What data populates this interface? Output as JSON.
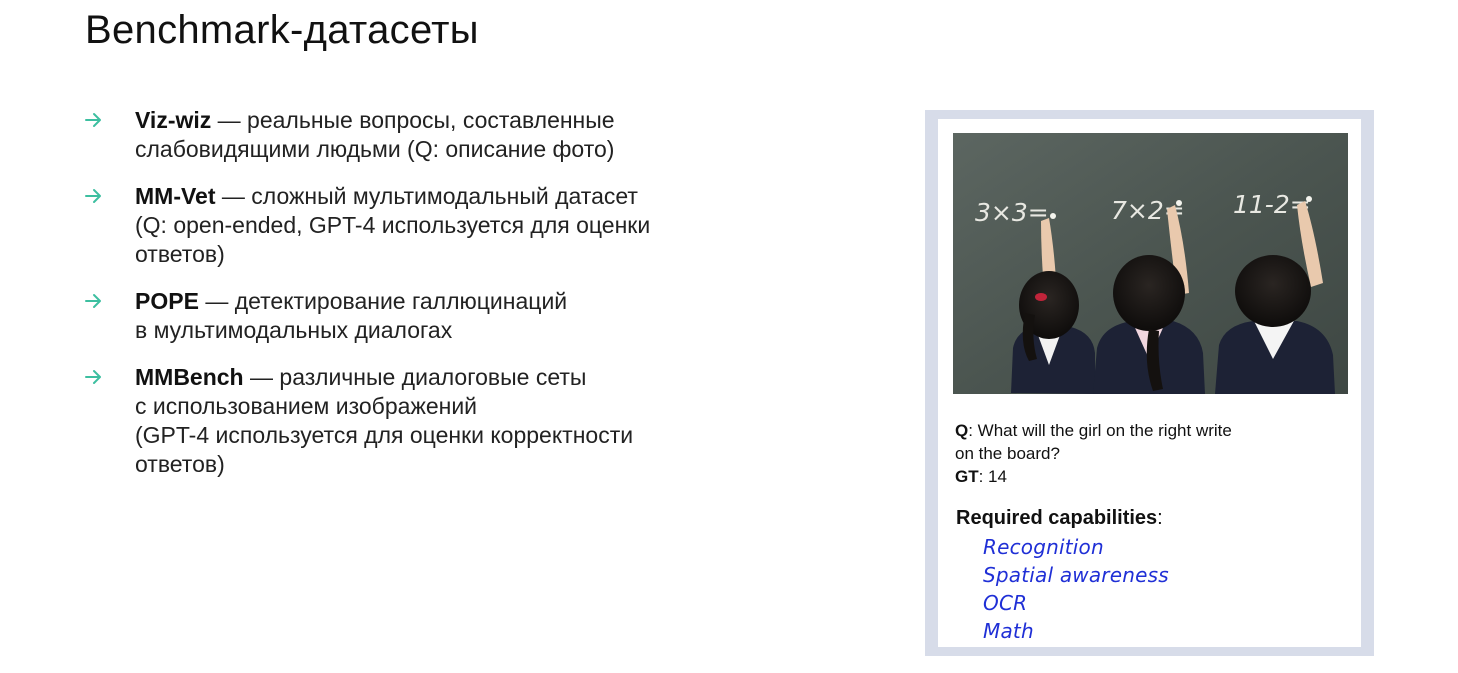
{
  "title": "Benchmark-датасеты",
  "accent_color": "#3dbfa0",
  "bullets": [
    {
      "name": "Viz-wiz",
      "lines": [
        "— реальные вопросы, составленные",
        "слабовидящими людьми (Q: описание фото)"
      ]
    },
    {
      "name": "MM-Vet",
      "lines": [
        "— сложный мультимодальный датасет",
        "(Q: open-ended, GPT-4 используется для оценки",
        "ответов)"
      ]
    },
    {
      "name": "POPE",
      "lines": [
        "— детектирование галлюцинаций",
        "в мультимодальных диалогах"
      ]
    },
    {
      "name": "MMBench",
      "lines": [
        "— различные диалоговые сеты",
        "с использованием изображений",
        "(GPT-4 используется для оценки корректности",
        "ответов)"
      ]
    }
  ],
  "example": {
    "board": [
      "3×3=",
      "7×2=",
      "11-2="
    ],
    "q_label": "Q",
    "question_line1": ": What will the girl on the right write",
    "question_line2": "on the board?",
    "gt_label": "GT",
    "gt_value": ": 14",
    "caps_label": "Required capabilities",
    "caps_colon": ":",
    "capabilities": [
      "Recognition",
      "Spatial awareness",
      "OCR",
      "Math"
    ]
  }
}
